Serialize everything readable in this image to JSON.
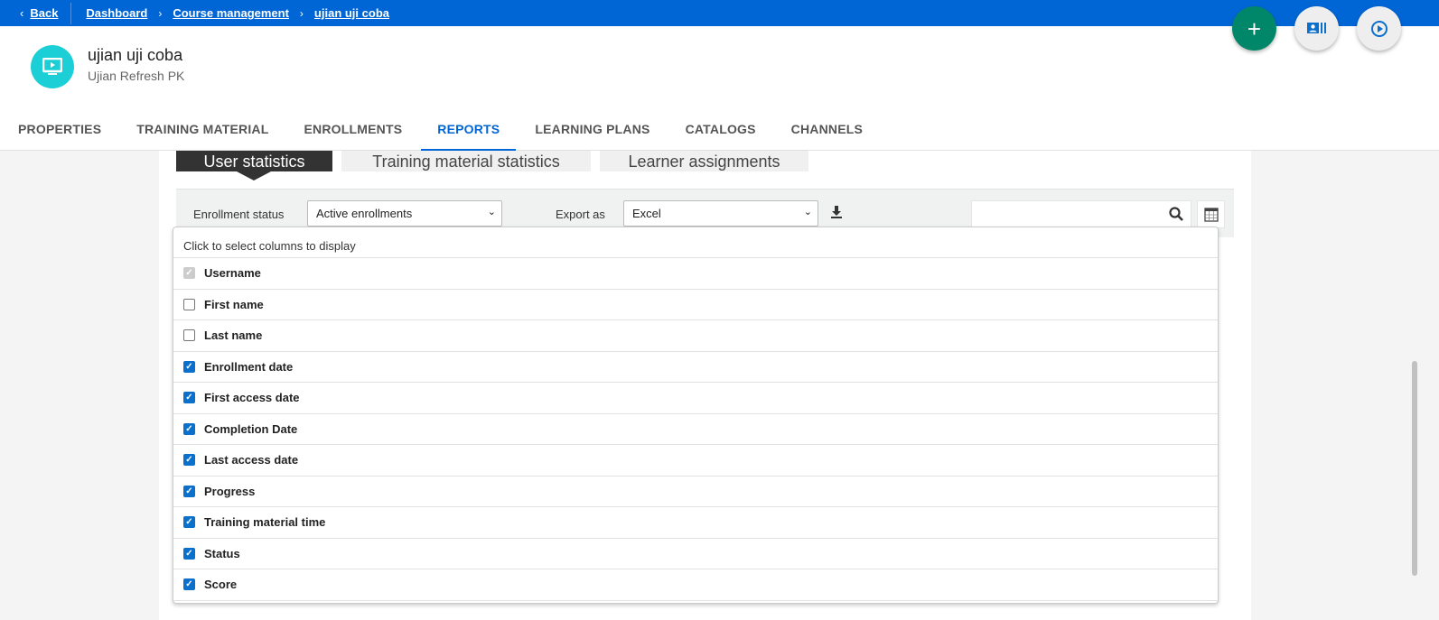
{
  "topbar": {
    "back": "Back",
    "breadcrumbs": [
      "Dashboard",
      "Course management",
      "ujian uji coba"
    ]
  },
  "course": {
    "title": "ujian uji coba",
    "subtitle": "Ujian Refresh PK"
  },
  "tabs": [
    "PROPERTIES",
    "TRAINING MATERIAL",
    "ENROLLMENTS",
    "REPORTS",
    "LEARNING PLANS",
    "CATALOGS",
    "CHANNELS"
  ],
  "active_tab": "REPORTS",
  "subtabs": [
    "User statistics",
    "Training material statistics",
    "Learner assignments"
  ],
  "toolbar": {
    "enrollment_label": "Enrollment status",
    "enrollment_value": "Active enrollments",
    "export_label": "Export as",
    "export_value": "Excel",
    "search_value": ""
  },
  "columns": {
    "hint": "Click to select columns to display",
    "items": [
      {
        "label": "Username",
        "checked": true,
        "disabled": true
      },
      {
        "label": "First name",
        "checked": false
      },
      {
        "label": "Last name",
        "checked": false
      },
      {
        "label": "Enrollment date",
        "checked": true
      },
      {
        "label": "First access date",
        "checked": true
      },
      {
        "label": "Completion Date",
        "checked": true
      },
      {
        "label": "Last access date",
        "checked": true
      },
      {
        "label": "Progress",
        "checked": true
      },
      {
        "label": "Training material time",
        "checked": true
      },
      {
        "label": "Status",
        "checked": true
      },
      {
        "label": "Score",
        "checked": true
      }
    ]
  },
  "colors": {
    "brand": "#0066d6",
    "fab_add": "#00876a",
    "avatar": "#1ccfd6",
    "checkbox": "#0b6fcc"
  }
}
